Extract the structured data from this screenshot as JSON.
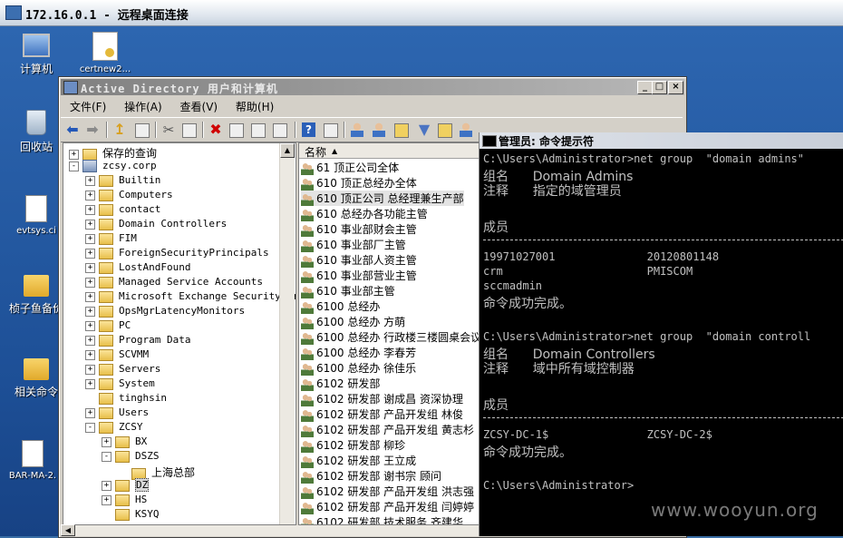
{
  "rdp": {
    "title": "172.16.0.1 - 远程桌面连接"
  },
  "desktop_icons": [
    {
      "label": "计算机",
      "icon": "computer-icon"
    },
    {
      "label": "certnew2...",
      "icon": "certificate-icon"
    },
    {
      "label": "回收站",
      "icon": "recycle-bin-icon"
    },
    {
      "label": "evtsys.ci",
      "icon": "file-icon"
    },
    {
      "label": "桢子鱼备价",
      "icon": "folder-icon"
    },
    {
      "label": "相关命令",
      "icon": "folder-icon"
    },
    {
      "label": "BAR-MA-2.",
      "icon": "file-icon"
    }
  ],
  "ad_window": {
    "title": "Active Directory 用户和计算机",
    "menu": [
      "文件(F)",
      "操作(A)",
      "查看(V)",
      "帮助(H)"
    ],
    "tree": [
      {
        "label": "保存的查询",
        "level": 0,
        "exp": "+",
        "type": "folder"
      },
      {
        "label": "zcsy.corp",
        "level": 0,
        "exp": "-",
        "type": "domain"
      },
      {
        "label": "Builtin",
        "level": 1,
        "exp": "+",
        "type": "folder"
      },
      {
        "label": "Computers",
        "level": 1,
        "exp": "+",
        "type": "folder"
      },
      {
        "label": "contact",
        "level": 1,
        "exp": "+",
        "type": "folder"
      },
      {
        "label": "Domain Controllers",
        "level": 1,
        "exp": "+",
        "type": "folder"
      },
      {
        "label": "FIM",
        "level": 1,
        "exp": "+",
        "type": "folder"
      },
      {
        "label": "ForeignSecurityPrincipals",
        "level": 1,
        "exp": "+",
        "type": "folder"
      },
      {
        "label": "LostAndFound",
        "level": 1,
        "exp": "+",
        "type": "folder"
      },
      {
        "label": "Managed Service Accounts",
        "level": 1,
        "exp": "+",
        "type": "folder"
      },
      {
        "label": "Microsoft Exchange Security Gr",
        "level": 1,
        "exp": "+",
        "type": "folder"
      },
      {
        "label": "OpsMgrLatencyMonitors",
        "level": 1,
        "exp": "+",
        "type": "folder"
      },
      {
        "label": "PC",
        "level": 1,
        "exp": "+",
        "type": "folder"
      },
      {
        "label": "Program Data",
        "level": 1,
        "exp": "+",
        "type": "folder"
      },
      {
        "label": "SCVMM",
        "level": 1,
        "exp": "+",
        "type": "folder"
      },
      {
        "label": "Servers",
        "level": 1,
        "exp": "+",
        "type": "folder"
      },
      {
        "label": "System",
        "level": 1,
        "exp": "+",
        "type": "folder"
      },
      {
        "label": "tinghsin",
        "level": 1,
        "exp": "",
        "type": "folder"
      },
      {
        "label": "Users",
        "level": 1,
        "exp": "+",
        "type": "folder"
      },
      {
        "label": "ZCSY",
        "level": 1,
        "exp": "-",
        "type": "folder"
      },
      {
        "label": "BX",
        "level": 2,
        "exp": "+",
        "type": "folder"
      },
      {
        "label": "DSZS",
        "level": 2,
        "exp": "-",
        "type": "folder"
      },
      {
        "label": "上海总部",
        "level": 3,
        "exp": "",
        "type": "folder"
      },
      {
        "label": "DZ",
        "level": 2,
        "exp": "+",
        "type": "folder"
      },
      {
        "label": "HS",
        "level": 2,
        "exp": "+",
        "type": "folder"
      },
      {
        "label": "KSYQ",
        "level": 2,
        "exp": "",
        "type": "folder"
      }
    ],
    "list_header": "名称",
    "list": [
      "61 顶正公司全体",
      "610     顶正总经办全体",
      "610   顶正公司 总经理兼生产部",
      "610   总经办各功能主管",
      "610   事业部财会主管",
      "610   事业部厂主管",
      "610   事业部人资主管",
      "610   事业部营业主管",
      "610   事业部主管",
      "6100  总经办",
      "6100 总经办  方萌",
      "6100 总经办 行政楼三楼圆桌会议",
      "6100 总经办 李春芳",
      "6100 总经办 徐佳乐",
      "6102    研发部",
      "6102   研发部    谢成昌 资深协理",
      "6102  研发部    产品开发组 林俊",
      "6102  研发部  产品开发组 黄志杉",
      "6102  研发部    柳珍",
      "6102  研发部    王立成",
      "6102  研发部    谢书宗 顾问",
      "6102  研发部  产品开发组   洪志强",
      "6102  研发部  产品开发组 闫婷婷",
      "6102  研发部  技术服务   齐建华"
    ]
  },
  "cmd": {
    "title": "管理员: 命令提示符",
    "lines": [
      {
        "text": "C:\\Users\\Administrator>net group  \"domain admins\"",
        "cjk": false
      },
      {
        "text": "组名      Domain Admins",
        "cjk": true
      },
      {
        "text": "注释      指定的域管理员",
        "cjk": true
      },
      {
        "text": "",
        "cjk": false
      },
      {
        "text": "成员",
        "cjk": true
      },
      {
        "text": "---",
        "cjk": false
      },
      {
        "text": "19971027001              20120801148",
        "cjk": false
      },
      {
        "text": "crm                      PMISCOM",
        "cjk": false
      },
      {
        "text": "sccmadmin",
        "cjk": false
      },
      {
        "text": "命令成功完成。",
        "cjk": true
      },
      {
        "text": "",
        "cjk": false
      },
      {
        "text": "C:\\Users\\Administrator>net group  \"domain controll",
        "cjk": false
      },
      {
        "text": "组名      Domain Controllers",
        "cjk": true
      },
      {
        "text": "注释      域中所有域控制器",
        "cjk": true
      },
      {
        "text": "",
        "cjk": false
      },
      {
        "text": "成员",
        "cjk": true
      },
      {
        "text": "---",
        "cjk": false
      },
      {
        "text": "ZCSY-DC-1$               ZCSY-DC-2$",
        "cjk": false
      },
      {
        "text": "命令成功完成。",
        "cjk": true
      },
      {
        "text": "",
        "cjk": false
      },
      {
        "text": "C:\\Users\\Administrator>",
        "cjk": false
      }
    ]
  },
  "watermark": "www.wooyun.org"
}
